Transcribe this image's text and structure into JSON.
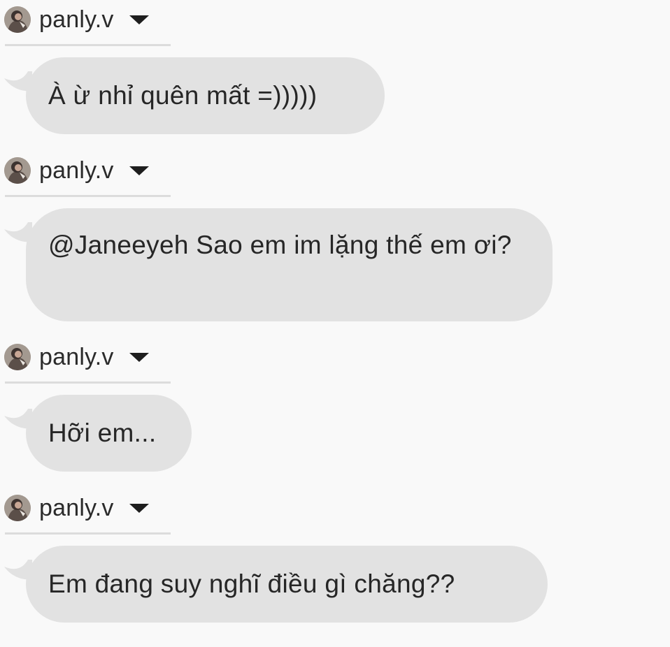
{
  "messages": [
    {
      "sender": "panly.v",
      "text": "À ừ nhỉ quên mất =)))))"
    },
    {
      "sender": "panly.v",
      "text": "@Janeeyeh Sao em im lặng thế em ơi?"
    },
    {
      "sender": "panly.v",
      "text": "Hỡi em..."
    },
    {
      "sender": "panly.v",
      "text": "Em đang suy nghĩ điều gì chăng??"
    }
  ],
  "colors": {
    "background": "#f9f9f9",
    "bubble": "#e2e2e2",
    "text": "#262626",
    "divider": "#dcdcdc"
  },
  "icons": {
    "avatar": "user-avatar-photo",
    "menu": "caret-down-icon"
  }
}
